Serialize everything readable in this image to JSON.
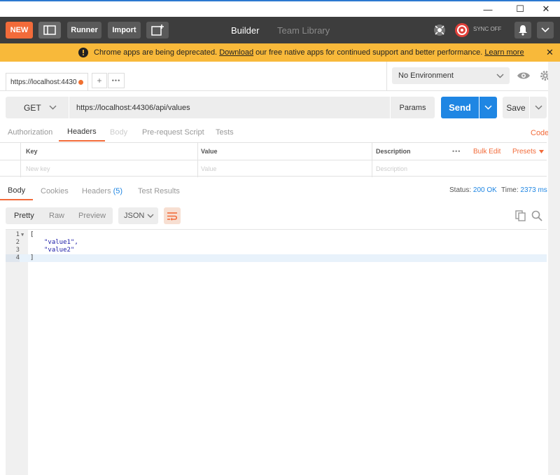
{
  "window": {
    "minimize": "—",
    "maximize": "☐",
    "close": "✕"
  },
  "toolbar": {
    "new_label": "NEW",
    "runner_label": "Runner",
    "import_label": "Import",
    "tabs": [
      {
        "label": "Builder"
      },
      {
        "label": "Team Library"
      }
    ],
    "sync_label": "SYNC OFF"
  },
  "banner": {
    "text_before": "Chrome apps are being deprecated.",
    "download_link": "Download",
    "text_after": "our free native apps for continued support and better performance.",
    "learn_more_link": "Learn more"
  },
  "request_tab": {
    "label": "https://localhost:4430"
  },
  "environment": {
    "selected": "No Environment"
  },
  "request": {
    "method": "GET",
    "url": "https://localhost:44306/api/values",
    "params_label": "Params",
    "send_label": "Send",
    "save_label": "Save"
  },
  "request_tabs": [
    "Authorization",
    "Headers",
    "Body",
    "Pre-request Script",
    "Tests"
  ],
  "code_link": "Code",
  "headers_table": {
    "columns": [
      "Key",
      "Value",
      "Description"
    ],
    "more": "•••",
    "bulk_edit": "Bulk Edit",
    "presets": "Presets",
    "placeholders": {
      "key": "New key",
      "value": "Value",
      "description": "Description"
    }
  },
  "response_tabs": {
    "body": "Body",
    "cookies": "Cookies",
    "headers": "Headers",
    "headers_count": "(5)",
    "test_results": "Test Results"
  },
  "response_status": {
    "status_label": "Status:",
    "status_value": "200 OK",
    "time_label": "Time:",
    "time_value": "2373 ms"
  },
  "response_format": {
    "options": [
      "Pretty",
      "Raw",
      "Preview"
    ],
    "selected": "Pretty",
    "language": "JSON"
  },
  "response_body": {
    "lines": [
      {
        "n": "1",
        "text": "["
      },
      {
        "n": "2",
        "text": "\"value1\","
      },
      {
        "n": "3",
        "text": "\"value2\""
      },
      {
        "n": "4",
        "text": "]"
      }
    ]
  },
  "colors": {
    "accent": "#f26b3a",
    "send": "#1f86e3",
    "toolbar": "#3d3d3d",
    "banner": "#f8b93a"
  },
  "icons": [
    "layout-icon",
    "new-window-icon",
    "satellite-icon",
    "sync-icon",
    "bell-icon",
    "chevron-down-icon",
    "warning-icon",
    "close-icon",
    "eye-icon",
    "gear-icon",
    "wrap-icon",
    "copy-icon",
    "search-icon"
  ]
}
